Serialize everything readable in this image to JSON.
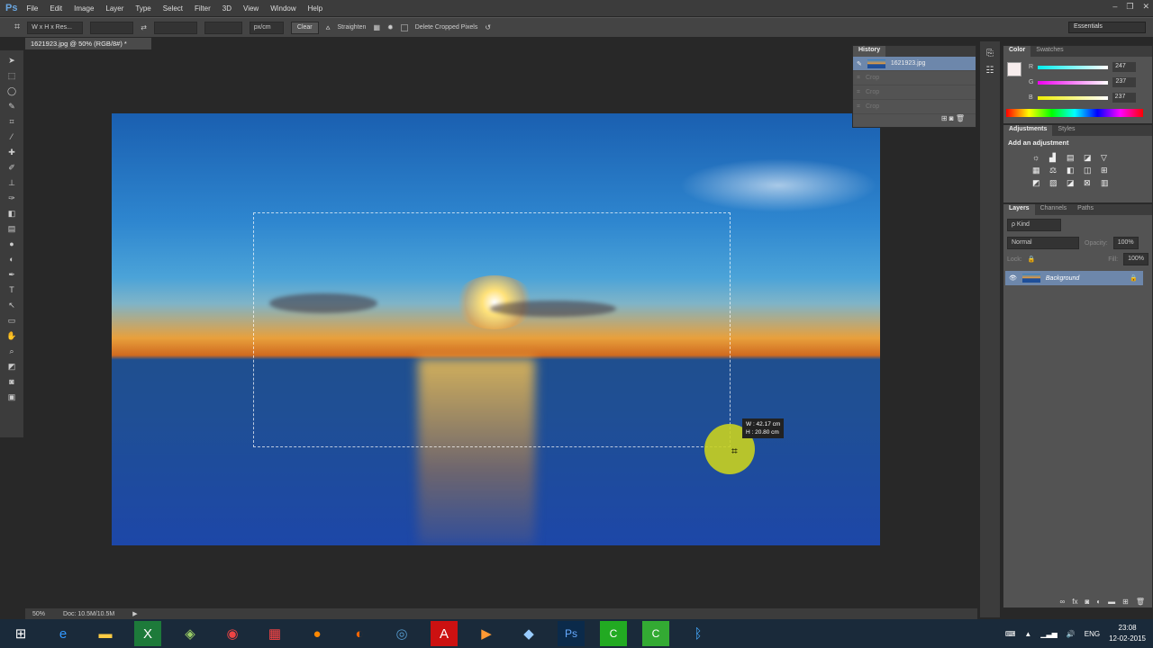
{
  "app": {
    "logo": "Ps",
    "menu": [
      "File",
      "Edit",
      "Image",
      "Layer",
      "Type",
      "Select",
      "Filter",
      "3D",
      "View",
      "Window",
      "Help"
    ]
  },
  "options": {
    "ratio": "W x H x Res...",
    "unit": "px/cm",
    "clear": "Clear",
    "straighten": "Straighten",
    "delete_cropped": "Delete Cropped Pixels",
    "workspace": "Essentials"
  },
  "document": {
    "tab": "1621923.jpg @ 50% (RGB/8#) *",
    "crop_w": "W :  42.17 cm",
    "crop_h": "H :  20.80 cm"
  },
  "status": {
    "zoom": "50%",
    "doc": "Doc: 10.5M/10.5M"
  },
  "history": {
    "title": "History",
    "items": [
      "1621923.jpg",
      "Crop",
      "Crop",
      "Crop"
    ]
  },
  "color": {
    "tabs": [
      "Color",
      "Swatches"
    ],
    "r": "247",
    "g": "237",
    "b": "237",
    "r_label": "R",
    "g_label": "G",
    "b_label": "B"
  },
  "adjustments": {
    "tabs": [
      "Adjustments",
      "Styles"
    ],
    "heading": "Add an adjustment"
  },
  "layers": {
    "tabs": [
      "Layers",
      "Channels",
      "Paths"
    ],
    "kind": "ρ Kind",
    "blend": "Normal",
    "opacity_label": "Opacity:",
    "opacity": "100%",
    "lock_label": "Lock:",
    "fill_label": "Fill:",
    "fill": "100%",
    "layer_name": "Background"
  },
  "tray": {
    "lang": "ENG",
    "time": "23:08",
    "date": "12-02-2015"
  }
}
